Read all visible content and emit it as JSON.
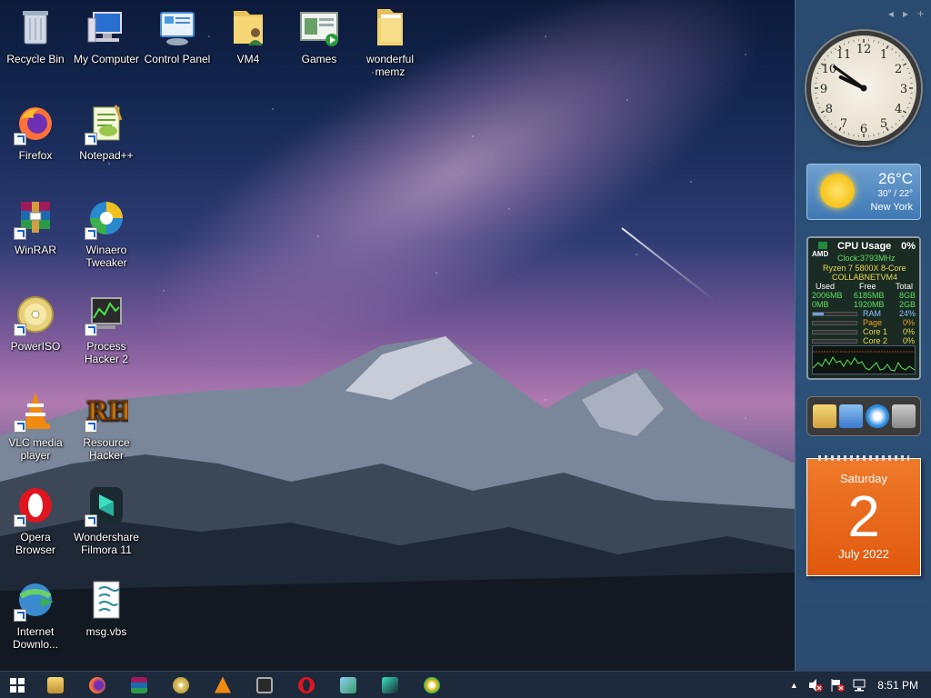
{
  "desktop": {
    "icons": [
      {
        "label": "Recycle Bin",
        "icon": "recycle-bin-icon"
      },
      {
        "label": "My Computer",
        "icon": "computer-icon"
      },
      {
        "label": "Control Panel",
        "icon": "control-panel-icon"
      },
      {
        "label": "VM4",
        "icon": "user-folder-icon"
      },
      {
        "label": "Games",
        "icon": "games-folder-icon"
      },
      {
        "label": "wonderful memz",
        "icon": "folder-icon"
      },
      {
        "label": "Firefox",
        "icon": "firefox-icon"
      },
      {
        "label": "Notepad++",
        "icon": "notepadpp-icon"
      },
      {
        "label": "WinRAR",
        "icon": "winrar-icon"
      },
      {
        "label": "Winaero Tweaker",
        "icon": "winaero-icon"
      },
      {
        "label": "PowerISO",
        "icon": "poweriso-icon"
      },
      {
        "label": "Process Hacker 2",
        "icon": "process-hacker-icon"
      },
      {
        "label": "VLC media player",
        "icon": "vlc-icon"
      },
      {
        "label": "Resource Hacker",
        "icon": "resource-hacker-icon"
      },
      {
        "label": "Opera Browser",
        "icon": "opera-icon"
      },
      {
        "label": "Wondershare Filmora 11",
        "icon": "filmora-icon"
      },
      {
        "label": "Internet Downlo...",
        "icon": "idm-icon"
      },
      {
        "label": "msg.vbs",
        "icon": "script-file-icon"
      }
    ]
  },
  "sidebar": {
    "controls": {
      "prev": "◂",
      "next": "▸",
      "add": "+"
    },
    "clock": {
      "hour": 9,
      "minute": 51,
      "numerals": [
        "12",
        "1",
        "2",
        "3",
        "4",
        "5",
        "6",
        "7",
        "8",
        "9",
        "10",
        "11"
      ]
    },
    "weather": {
      "temp": "26°C",
      "range": "30° / 22°",
      "city": "New York"
    },
    "cpu": {
      "title": "CPU Usage",
      "percent": "0%",
      "brand": "AMD",
      "clock": "Clock:3793MHz",
      "model": "Ryzen 7 5800X 8-Core",
      "host": "COLLABNETVM4",
      "headers": {
        "used": "Used",
        "free": "Free",
        "total": "Total"
      },
      "mem_row": {
        "used": "2006MB",
        "free": "6185MB",
        "total": "8GB"
      },
      "swap_row": {
        "used": "0MB",
        "free": "1920MB",
        "total": "2GB"
      },
      "ram": {
        "label": "RAM",
        "value": "24%",
        "level": 0.24
      },
      "page": {
        "label": "Page",
        "value": "0%"
      },
      "core1": {
        "label": "Core 1",
        "value": "0%"
      },
      "core2": {
        "label": "Core 2",
        "value": "0%"
      }
    },
    "calendar": {
      "day": "Saturday",
      "date": "2",
      "month": "July 2022"
    }
  },
  "taskbar": {
    "apps": [
      "file-explorer-icon",
      "firefox-icon",
      "winrar-icon",
      "poweriso-icon",
      "vlc-icon",
      "process-hacker-icon",
      "opera-icon",
      "resource-hacker-icon",
      "filmora-icon",
      "winaero-icon"
    ],
    "tray": {
      "chevron": "▲",
      "time": "8:51 PM"
    }
  }
}
